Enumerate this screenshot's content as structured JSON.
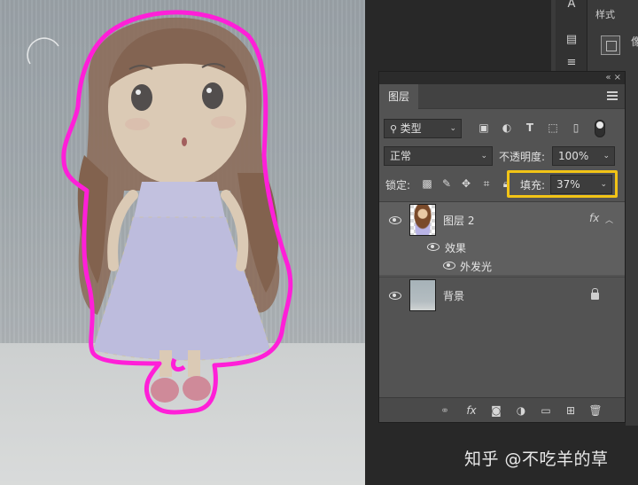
{
  "watermark": "知乎 @不吃羊的草",
  "styles_panel": {
    "tab_label": "样式",
    "edge_glyph": "像"
  },
  "layers_panel": {
    "tab_label": "图层",
    "filter": {
      "kind_label": "类型"
    },
    "blend_mode": "正常",
    "opacity_label": "不透明度:",
    "opacity_value": "100%",
    "lock_label": "锁定:",
    "fill_label": "填充:",
    "fill_value": "37%",
    "layers": [
      {
        "name": "图层 2",
        "fx": "fx",
        "effects_label": "效果",
        "effect": "外发光",
        "selected": true
      },
      {
        "name": "背景",
        "locked": true
      }
    ],
    "bottom_icons": [
      "link-icon",
      "fx-icon",
      "mask-icon",
      "adjustment-icon",
      "folder-icon",
      "new-layer-icon",
      "trash-icon"
    ]
  },
  "colors": {
    "highlight": "#f2c416",
    "glow": "#ff1fd8",
    "panel": "#535353"
  }
}
